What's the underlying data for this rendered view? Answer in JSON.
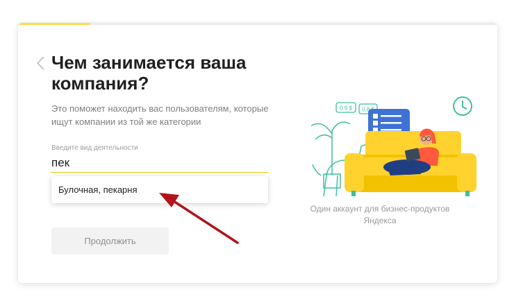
{
  "progress": {
    "fraction": 0.15,
    "color": "#ffdb4d"
  },
  "page": {
    "title": "Чем занимается ваша компания?",
    "subtitle": "Это поможет находить вас пользователям, которые ищут компании из той же категории"
  },
  "form": {
    "field_label": "Введите вид деятельности",
    "field_value": "пек",
    "suggestions": [
      "Булочная, пекарня"
    ],
    "continue_label": "Продолжить"
  },
  "illustration": {
    "price_tags": [
      "0.9 $",
      "0.8 $"
    ],
    "caption": "Один аккаунт для бизнес-продуктов Яндекса"
  },
  "colors": {
    "accent": "#ffdb4d",
    "sofa": "#ffd22e",
    "teal": "#3fbf9f",
    "blue": "#3e72d6",
    "arrow": "#b0131a"
  }
}
